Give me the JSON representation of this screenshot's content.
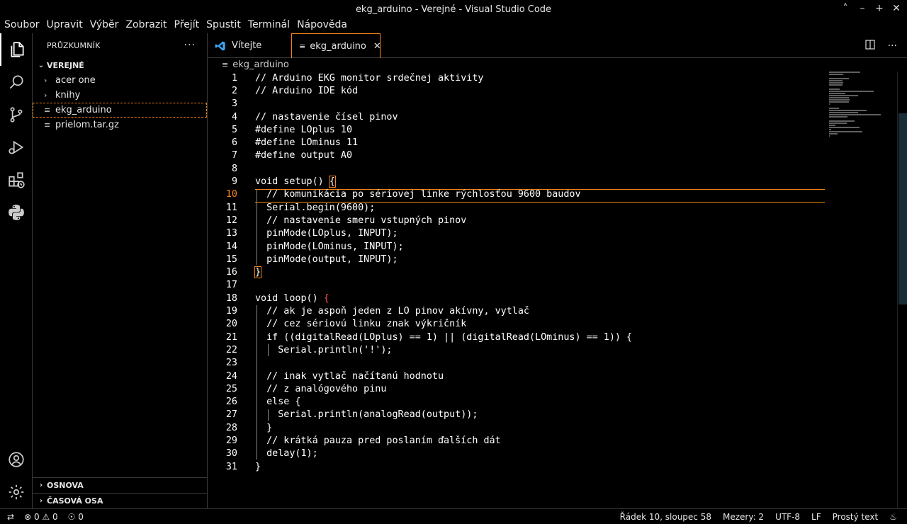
{
  "window": {
    "title": "ekg_arduino - Verejné - Visual Studio Code",
    "controls": [
      "˄",
      "–",
      "+",
      "✕"
    ]
  },
  "menu": [
    "Soubor",
    "Upravit",
    "Výběr",
    "Zobrazit",
    "Přejít",
    "Spustit",
    "Terminál",
    "Nápověda"
  ],
  "sidebar": {
    "title": "PRŮZKUMNÍK",
    "more": "···",
    "folder": "VEREJNÉ",
    "items": [
      {
        "label": "acer one",
        "type": "folder"
      },
      {
        "label": "knihy",
        "type": "folder"
      },
      {
        "label": "ekg_arduino",
        "type": "file"
      },
      {
        "label": "prielom.tar.gz",
        "type": "file"
      }
    ],
    "bottom_sections": [
      "OSNOVA",
      "ČASOVÁ OSA"
    ]
  },
  "tabs": [
    {
      "label": "Vítejte",
      "icon": "vscode-logo-icon"
    },
    {
      "label": "ekg_arduino",
      "icon": "file-lines-icon",
      "close": "✕"
    }
  ],
  "breadcrumb": "ekg_arduino",
  "editor": {
    "current_line": 10,
    "lines": [
      "// Arduino EKG monitor srdečnej aktivity",
      "// Arduino IDE kód",
      "",
      "// nastavenie čísel pinov",
      "#define LOplus 10",
      "#define LOminus 11",
      "#define output A0",
      "",
      "void setup() {",
      "  // komunikácia po sériovej linke rýchlosťou 9600 baudov",
      "  Serial.begin(9600);",
      "  // nastavenie smeru vstupných pinov",
      "  pinMode(LOplus, INPUT);",
      "  pinMode(LOminus, INPUT);",
      "  pinMode(output, INPUT);",
      "}",
      "",
      "void loop() {",
      "  // ak je aspoň jeden z LO pinov akívny, vytlač",
      "  // cez sériovú linku znak výkričník",
      "  if ((digitalRead(LOplus) == 1) || (digitalRead(LOminus) == 1)) {",
      "    Serial.println('!');",
      "",
      "  // inak vytlač načítanú hodnotu",
      "  // z analógového pinu",
      "  else {",
      "    Serial.println(analogRead(output));",
      "  }",
      "  // krátká pauza pred poslaním ďalších dát",
      "  delay(1);",
      "}"
    ]
  },
  "statusbar": {
    "errors": "0",
    "warnings": "0",
    "ports": "0",
    "position": "Řádek 10, sloupec 58",
    "spaces": "Mezery: 2",
    "encoding": "UTF-8",
    "eol": "LF",
    "language": "Prostý text"
  },
  "colors": {
    "focus": "#f38518",
    "brace_unmatched": "#f14c4c",
    "background": "#000000"
  }
}
